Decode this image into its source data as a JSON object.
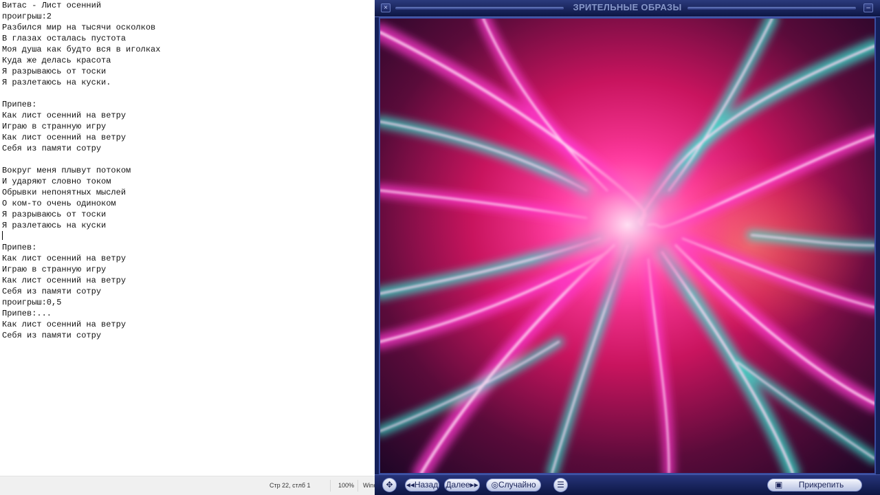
{
  "editor": {
    "lines": [
      "Витас - Лист осенний",
      "проигрыш:2",
      "Разбился мир на тысячи осколков",
      "В глазах осталась пустота",
      "Моя душа как будто вся в иголках",
      "Куда же делась красота",
      "Я разрываюсь от тоски",
      "Я разлетаюсь на куски.",
      "",
      "Припев:",
      "Как лист осенний на ветру",
      "Играю в странную игру",
      "Как лист осенний на ветру",
      "Себя из памяти сотру",
      "",
      "Вокруг меня плывут потоком",
      "И ударяют словно током",
      "Обрывки непонятных мыслей",
      "О ком-то очень одиноком",
      "Я разрываюсь от тоски",
      "Я разлетаюсь на куски",
      "",
      "Припев:",
      "Как лист осенний на ветру",
      "Играю в странную игру",
      "Как лист осенний на ветру",
      "Себя из памяти сотру",
      "проигрыш:0,5",
      "Припев:...",
      "Как лист осенний на ветру",
      "Себя из памяти сотру"
    ]
  },
  "statusbar": {
    "position": "Стр 22, стлб 1",
    "zoom": "100%",
    "encoding": "Wind"
  },
  "visualizer": {
    "title": "ЗРИТЕЛЬНЫЕ ОБРАЗЫ",
    "controls": {
      "back_label": "Назад",
      "next_label": "Далее",
      "random_label": "Случайно",
      "attach_label": "Прикрепить"
    },
    "colors": {
      "frame": "#14205a",
      "glow_magenta": "#ff3ad0",
      "glow_cyan": "#39e6d2",
      "core_pink": "#ff6ec0"
    }
  }
}
